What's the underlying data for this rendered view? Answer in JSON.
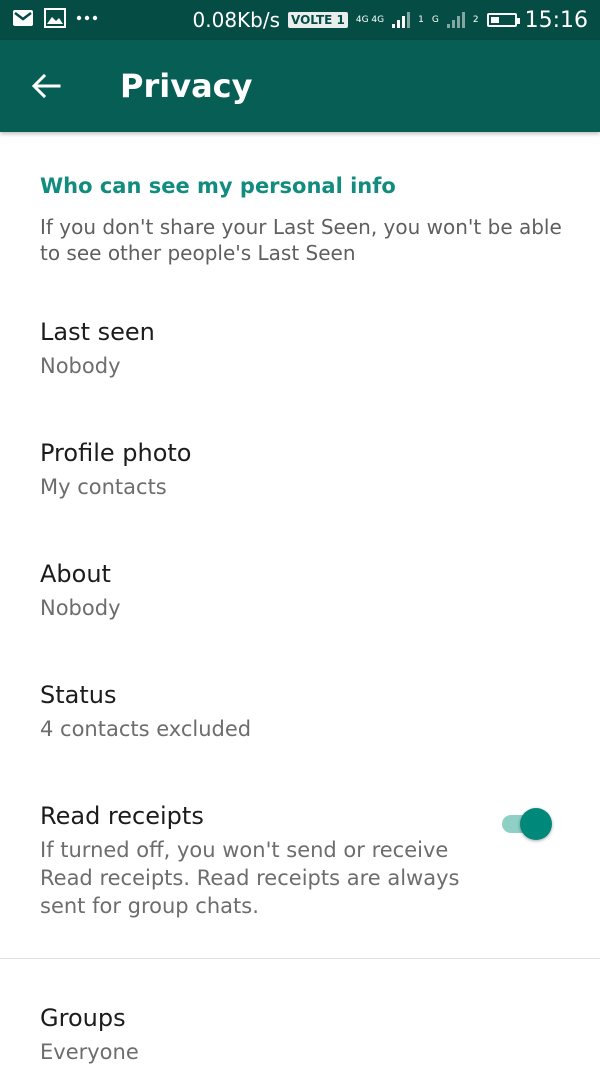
{
  "status_bar": {
    "speed": "0.08Kb/s",
    "volte": "VOLTE 1",
    "net1": "4G 4G",
    "sim1": "1",
    "net2": "G",
    "sim2": "2",
    "time": "15:16",
    "icons": [
      "gmail-icon",
      "gallery-icon",
      "more-dots-icon",
      "signal-icon",
      "battery-icon"
    ]
  },
  "app_bar": {
    "title": "Privacy",
    "background": "#075e54",
    "status_background": "#054d44"
  },
  "section": {
    "header": "Who can see my personal info",
    "description": "If you don't share your Last Seen, you won't be able to see other people's Last Seen",
    "accent": "#128c7e"
  },
  "prefs": [
    {
      "title": "Last seen",
      "value": "Nobody"
    },
    {
      "title": "Profile photo",
      "value": "My contacts"
    },
    {
      "title": "About",
      "value": "Nobody"
    },
    {
      "title": "Status",
      "value": "4 contacts excluded"
    },
    {
      "title": "Read receipts",
      "value": "If turned off, you won't send or receive Read receipts. Read receipts are always sent for group chats.",
      "enabled": true
    },
    {
      "title": "Groups",
      "value": "Everyone"
    }
  ]
}
